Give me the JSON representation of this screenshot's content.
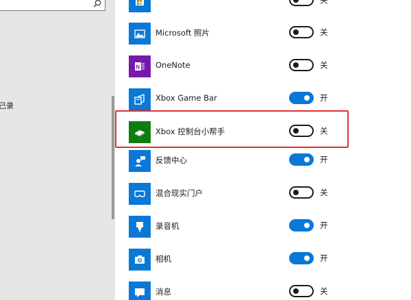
{
  "left_pane": {
    "search_placeholder": "",
    "partial_item_text": "己录"
  },
  "apps": [
    {
      "name": "",
      "icon": "store-icon",
      "icon_bg": "#0a78d7",
      "toggle_on": false,
      "state_label": "关"
    },
    {
      "name": "Microsoft 照片",
      "icon": "photos-icon",
      "icon_bg": "#0a78d7",
      "toggle_on": false,
      "state_label": "关"
    },
    {
      "name": "OneNote",
      "icon": "onenote-icon",
      "icon_bg": "#7719aa",
      "toggle_on": false,
      "state_label": "关"
    },
    {
      "name": "Xbox Game Bar",
      "icon": "xbox-game-bar-icon",
      "icon_bg": "#0a78d7",
      "toggle_on": true,
      "state_label": "开"
    },
    {
      "name": "Xbox 控制台小帮手",
      "icon": "xbox-console-icon",
      "icon_bg": "#107c10",
      "toggle_on": false,
      "state_label": "关"
    },
    {
      "name": "反馈中心",
      "icon": "feedback-hub-icon",
      "icon_bg": "#0a78d7",
      "toggle_on": true,
      "state_label": "开"
    },
    {
      "name": "混合现实门户",
      "icon": "mixed-reality-icon",
      "icon_bg": "#0a78d7",
      "toggle_on": false,
      "state_label": "关"
    },
    {
      "name": "录音机",
      "icon": "voice-recorder-icon",
      "icon_bg": "#0a78d7",
      "toggle_on": true,
      "state_label": "开"
    },
    {
      "name": "相机",
      "icon": "camera-icon",
      "icon_bg": "#0a78d7",
      "toggle_on": true,
      "state_label": "开"
    },
    {
      "name": "消息",
      "icon": "messaging-icon",
      "icon_bg": "#0a78d7",
      "toggle_on": false,
      "state_label": "关"
    }
  ],
  "colors": {
    "accent": "#0a78d7",
    "highlight": "#e0312f"
  }
}
